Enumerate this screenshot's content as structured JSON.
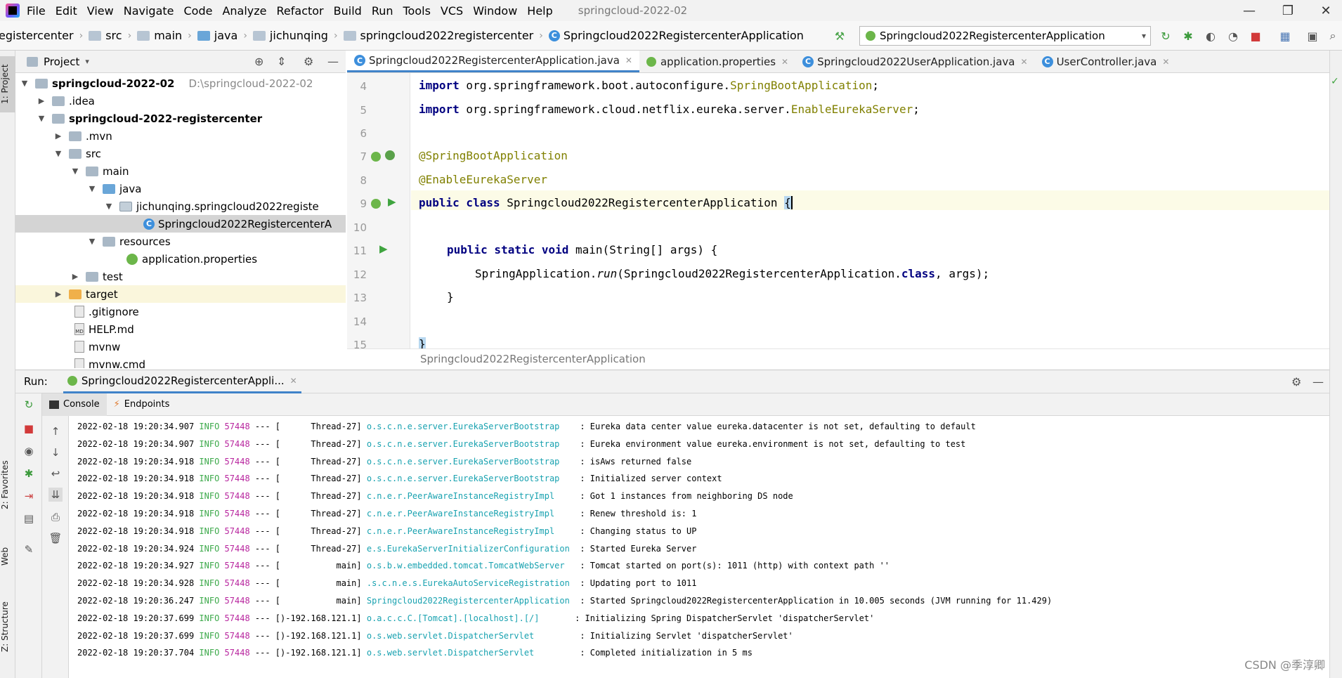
{
  "menu": {
    "items": [
      "File",
      "Edit",
      "View",
      "Navigate",
      "Code",
      "Analyze",
      "Refactor",
      "Build",
      "Run",
      "Tools",
      "VCS",
      "Window",
      "Help"
    ],
    "window_title": "springcloud-2022-02",
    "minimize": "—",
    "maximize": "❐",
    "close": "✕"
  },
  "navbar": {
    "crumbs": [
      "egistercenter",
      "src",
      "main",
      "java",
      "jichunqing",
      "springcloud2022registercenter",
      "Springcloud2022RegistercenterApplication"
    ],
    "run_config": "Springcloud2022RegistercenterApplication"
  },
  "left_stripe": {
    "project_tab": "1: Project",
    "favorites_tab": "2: Favorites",
    "web_tab": "Web",
    "structure_tab": "Z: Structure"
  },
  "project_panel": {
    "title": "Project",
    "tree": [
      {
        "label": "springcloud-2022-02",
        "hint": "D:\\springcloud-2022-02"
      },
      {
        "label": ".idea"
      },
      {
        "label": "springcloud-2022-registercenter"
      },
      {
        "label": ".mvn"
      },
      {
        "label": "src"
      },
      {
        "label": "main"
      },
      {
        "label": "java"
      },
      {
        "label": "jichunqing.springcloud2022registe"
      },
      {
        "label": "Springcloud2022RegistercenterA"
      },
      {
        "label": "resources"
      },
      {
        "label": "application.properties"
      },
      {
        "label": "test"
      },
      {
        "label": "target"
      },
      {
        "label": ".gitignore"
      },
      {
        "label": "HELP.md"
      },
      {
        "label": "mvnw"
      },
      {
        "label": "mvnw.cmd"
      }
    ]
  },
  "editor": {
    "tabs": [
      "Springcloud2022RegistercenterApplication.java",
      "application.properties",
      "Springcloud2022UserApplication.java",
      "UserController.java"
    ],
    "line_numbers": [
      "4",
      "5",
      "6",
      "7",
      "8",
      "9",
      "10",
      "11",
      "12",
      "13",
      "14",
      "15"
    ],
    "lines": {
      "l4_kw": "import",
      "l4_pkg": " org.springframework.boot.autoconfigure.",
      "l4_cls": "SpringBootApplication",
      "l4_end": ";",
      "l5_kw": "import",
      "l5_pkg": " org.springframework.cloud.netflix.eureka.server.",
      "l5_cls": "EnableEurekaServer",
      "l5_end": ";",
      "l7": "@SpringBootApplication",
      "l8": "@EnableEurekaServer",
      "l9_kw": "public class",
      "l9_name": " Springcloud2022RegistercenterApplication ",
      "l9_brace": "{",
      "l11_kw": "public static void",
      "l11_rest": " main(String[] args) {",
      "l12_a": "SpringApplication.",
      "l12_run": "run",
      "l12_b": "(Springcloud2022RegistercenterApplication.",
      "l12_cls": "class",
      "l12_c": ", args);",
      "l13": "}",
      "l15": "}"
    },
    "breadcrumb": "Springcloud2022RegistercenterApplication"
  },
  "run_panel": {
    "label": "Run:",
    "tab": "Springcloud2022RegistercenterAppli...",
    "console_tab": "Console",
    "endpoints_tab": "Endpoints",
    "logs": [
      {
        "ts": "2022-02-18 19:20:34.907",
        "lvl": "INFO",
        "pid": "57448",
        "thr": "--- [      Thread-27]",
        "logger": "o.s.c.n.e.server.EurekaServerBootstrap   ",
        "msg": ": Eureka data center value eureka.datacenter is not set, defaulting to default"
      },
      {
        "ts": "2022-02-18 19:20:34.907",
        "lvl": "INFO",
        "pid": "57448",
        "thr": "--- [      Thread-27]",
        "logger": "o.s.c.n.e.server.EurekaServerBootstrap   ",
        "msg": ": Eureka environment value eureka.environment is not set, defaulting to test"
      },
      {
        "ts": "2022-02-18 19:20:34.918",
        "lvl": "INFO",
        "pid": "57448",
        "thr": "--- [      Thread-27]",
        "logger": "o.s.c.n.e.server.EurekaServerBootstrap   ",
        "msg": ": isAws returned false"
      },
      {
        "ts": "2022-02-18 19:20:34.918",
        "lvl": "INFO",
        "pid": "57448",
        "thr": "--- [      Thread-27]",
        "logger": "o.s.c.n.e.server.EurekaServerBootstrap   ",
        "msg": ": Initialized server context"
      },
      {
        "ts": "2022-02-18 19:20:34.918",
        "lvl": "INFO",
        "pid": "57448",
        "thr": "--- [      Thread-27]",
        "logger": "c.n.e.r.PeerAwareInstanceRegistryImpl    ",
        "msg": ": Got 1 instances from neighboring DS node"
      },
      {
        "ts": "2022-02-18 19:20:34.918",
        "lvl": "INFO",
        "pid": "57448",
        "thr": "--- [      Thread-27]",
        "logger": "c.n.e.r.PeerAwareInstanceRegistryImpl    ",
        "msg": ": Renew threshold is: 1"
      },
      {
        "ts": "2022-02-18 19:20:34.918",
        "lvl": "INFO",
        "pid": "57448",
        "thr": "--- [      Thread-27]",
        "logger": "c.n.e.r.PeerAwareInstanceRegistryImpl    ",
        "msg": ": Changing status to UP"
      },
      {
        "ts": "2022-02-18 19:20:34.924",
        "lvl": "INFO",
        "pid": "57448",
        "thr": "--- [      Thread-27]",
        "logger": "e.s.EurekaServerInitializerConfiguration ",
        "msg": ": Started Eureka Server"
      },
      {
        "ts": "2022-02-18 19:20:34.927",
        "lvl": "INFO",
        "pid": "57448",
        "thr": "--- [           main]",
        "logger": "o.s.b.w.embedded.tomcat.TomcatWebServer  ",
        "msg": ": Tomcat started on port(s): 1011 (http) with context path ''"
      },
      {
        "ts": "2022-02-18 19:20:34.928",
        "lvl": "INFO",
        "pid": "57448",
        "thr": "--- [           main]",
        "logger": ".s.c.n.e.s.EurekaAutoServiceRegistration ",
        "msg": ": Updating port to 1011"
      },
      {
        "ts": "2022-02-18 19:20:36.247",
        "lvl": "INFO",
        "pid": "57448",
        "thr": "--- [           main]",
        "logger": "Springcloud2022RegistercenterApplication ",
        "msg": ": Started Springcloud2022RegistercenterApplication in 10.005 seconds (JVM running for 11.429)"
      },
      {
        "ts": "2022-02-18 19:20:37.699",
        "lvl": "INFO",
        "pid": "57448",
        "thr": "--- [)-192.168.121.1]",
        "logger": "o.a.c.c.C.[Tomcat].[localhost].[/]      ",
        "msg": ": Initializing Spring DispatcherServlet 'dispatcherServlet'"
      },
      {
        "ts": "2022-02-18 19:20:37.699",
        "lvl": "INFO",
        "pid": "57448",
        "thr": "--- [)-192.168.121.1]",
        "logger": "o.s.web.servlet.DispatcherServlet        ",
        "msg": ": Initializing Servlet 'dispatcherServlet'"
      },
      {
        "ts": "2022-02-18 19:20:37.704",
        "lvl": "INFO",
        "pid": "57448",
        "thr": "--- [)-192.168.121.1]",
        "logger": "o.s.web.servlet.DispatcherServlet        ",
        "msg": ": Completed initialization in 5 ms"
      }
    ]
  },
  "watermark": "CSDN @季淳卿",
  "colors": {
    "accent": "#4083c9",
    "log_level": "#3ca94a",
    "log_pid": "#b8259e",
    "log_logger": "#19a2b0",
    "keyword": "#000080",
    "annotation": "#808000"
  }
}
